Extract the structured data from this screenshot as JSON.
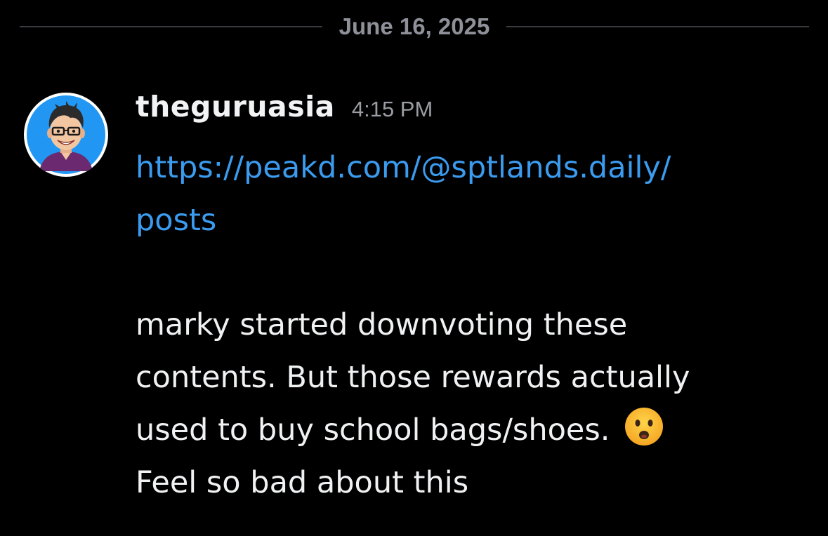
{
  "date_divider": {
    "label": "June 16, 2025"
  },
  "message": {
    "username": "theguruasia",
    "timestamp": "4:15 PM",
    "link_line1": "https://peakd.com/@sptlands.daily/",
    "link_line2": "posts",
    "text_line1": "marky started downvoting these",
    "text_line2": "contents. But those rewards actually",
    "text_line3": "used to buy school bags/shoes.",
    "text_line4": "Feel so bad about this",
    "emoji": "frowning-face-with-open-mouth-icon"
  },
  "colors": {
    "background": "#000000",
    "link": "#3b9bef",
    "username": "#f2f3f5",
    "timestamp": "#9a9ca3",
    "divider": "#3a3c42",
    "avatar_background": "#2196f3"
  }
}
